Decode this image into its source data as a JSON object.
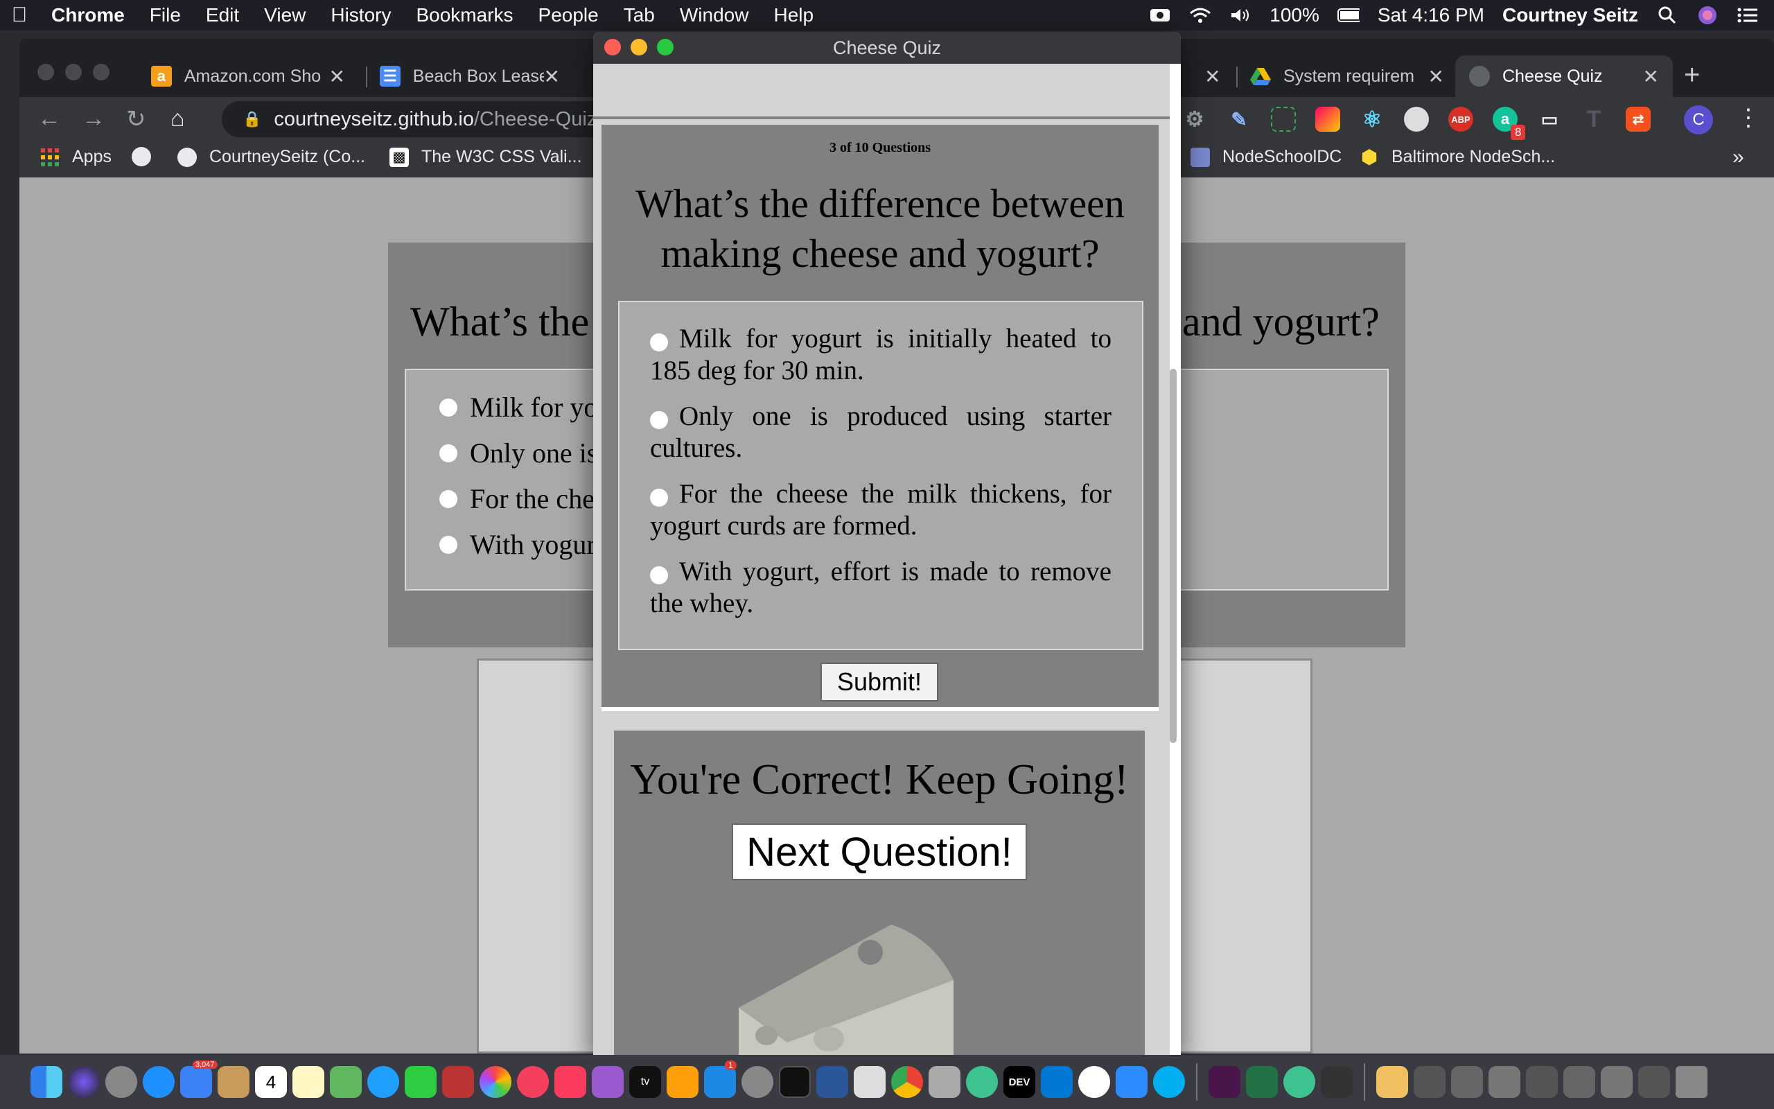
{
  "menubar": {
    "app": "Chrome",
    "items": [
      "File",
      "Edit",
      "View",
      "History",
      "Bookmarks",
      "People",
      "Tab",
      "Window",
      "Help"
    ],
    "battery": "100%",
    "clock": "Sat 4:16 PM",
    "user": "Courtney Seitz"
  },
  "browser": {
    "tabs": [
      {
        "label": "Amazon.com Sho",
        "icon": "amazon-icon"
      },
      {
        "label": "Beach Box Lease",
        "icon": "docs-icon"
      },
      {
        "label": "System requirem",
        "icon": "drive-icon"
      },
      {
        "label": "Cheese Quiz",
        "icon": "globe-icon"
      }
    ],
    "url_host": "courtneyseitz.github.io",
    "url_path": "/Cheese-Quiz/",
    "profile_initial": "C",
    "bookmarks": [
      "Apps",
      "CourtneySeitz (Co...",
      "The W3C CSS Vali...",
      "NodeSchoolDC",
      "Baltimore NodeSch..."
    ],
    "extension_badges": {
      "abp": "ABP",
      "grammarly_count": "8"
    }
  },
  "background_page": {
    "question_left": "What’s the",
    "question_right": "and yogurt?",
    "options": [
      "Milk for yo",
      "Only one is",
      "For the che",
      "With yogur"
    ]
  },
  "popup": {
    "window_title": "Cheese Quiz",
    "counter": "3 of 10 Questions",
    "question": "What’s the difference between making cheese and yogurt?",
    "options": [
      "Milk for yogurt is initially heated to 185 deg for 30 min.",
      "Only one is produced using starter cultures.",
      "For the cheese the milk thickens, for yogurt curds are formed.",
      "With yogurt, effort is made to remove the whey."
    ],
    "submit_label": "Submit!",
    "feedback": "You're Correct! Keep Going!",
    "next_label": "Next Question!"
  },
  "dock": {
    "badges": {
      "mail_count": "3,047",
      "calendar_day": "4",
      "appstore_count": "1"
    }
  },
  "colors": {
    "quiz_gray": "#808080",
    "answer_gray": "#a9a9a9",
    "light_gray": "#d3d3d3"
  }
}
